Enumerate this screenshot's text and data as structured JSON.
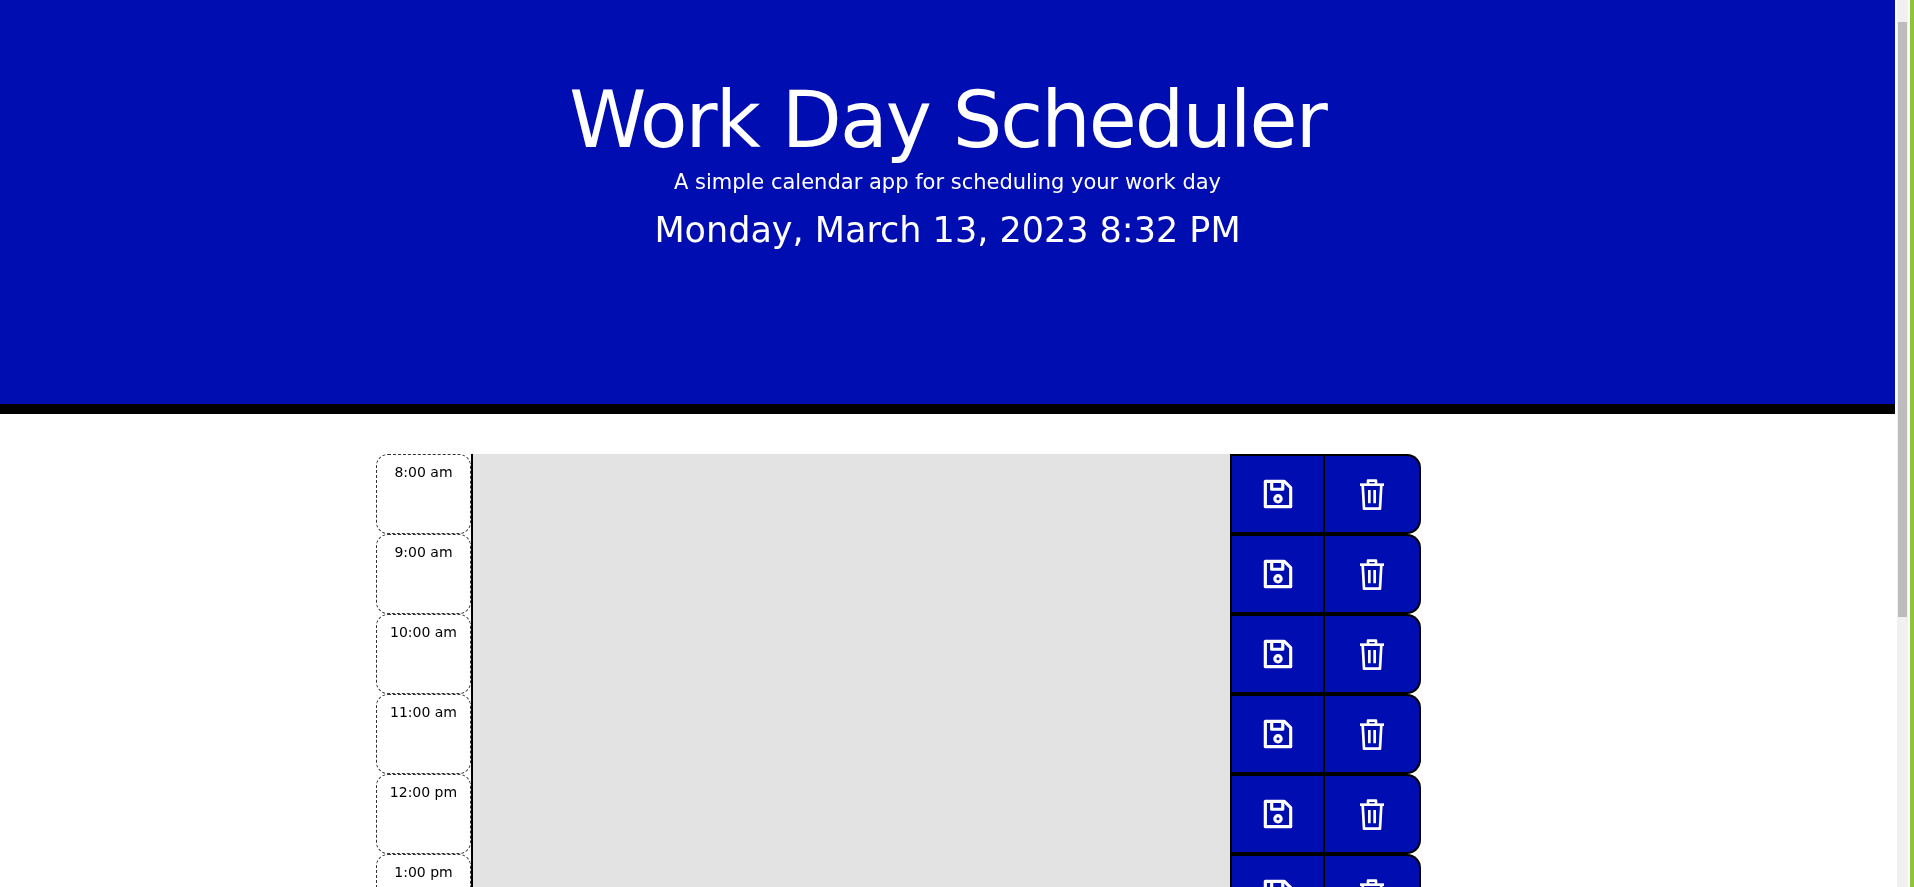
{
  "header": {
    "title": "Work Day Scheduler",
    "subtitle": "A simple calendar app for scheduling your work day",
    "current_date": "Monday, March 13, 2023 8:32 PM"
  },
  "time_blocks": [
    {
      "hour": "8:00 am"
    },
    {
      "hour": "9:00 am"
    },
    {
      "hour": "10:00 am"
    },
    {
      "hour": "11:00 am"
    },
    {
      "hour": "12:00 pm"
    },
    {
      "hour": "1:00 pm"
    }
  ]
}
